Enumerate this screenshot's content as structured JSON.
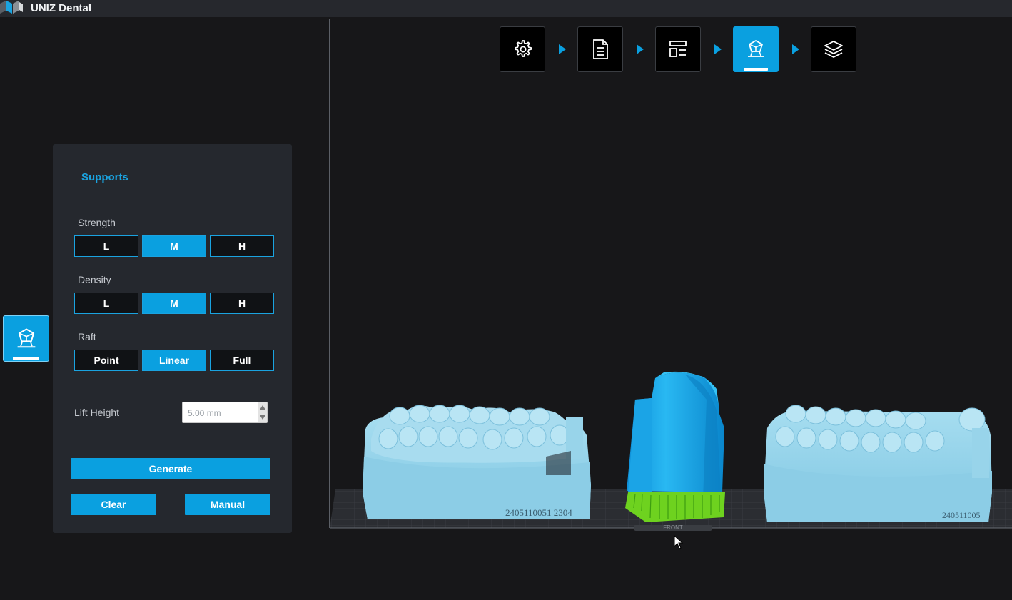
{
  "app": {
    "title": "UNIZ Dental"
  },
  "steps": [
    {
      "name": "settings",
      "icon": "gear-icon",
      "active": false
    },
    {
      "name": "document",
      "icon": "document-icon",
      "active": false
    },
    {
      "name": "layout",
      "icon": "layout-icon",
      "active": false
    },
    {
      "name": "supports",
      "icon": "supports-icon",
      "active": true
    },
    {
      "name": "layers",
      "icon": "layers-icon",
      "active": false
    }
  ],
  "panel": {
    "title": "Supports",
    "strength": {
      "label": "Strength",
      "options": [
        "L",
        "M",
        "H"
      ],
      "selected": "M"
    },
    "density": {
      "label": "Density",
      "options": [
        "L",
        "M",
        "H"
      ],
      "selected": "M"
    },
    "raft": {
      "label": "Raft",
      "options": [
        "Point",
        "Linear",
        "Full"
      ],
      "selected": "Linear"
    },
    "lift_height": {
      "label": "Lift Height",
      "value": "5.00 mm"
    },
    "generate_label": "Generate",
    "clear_label": "Clear",
    "manual_label": "Manual"
  },
  "viewport": {
    "model_labels": [
      "2405110051   2304",
      "240511005"
    ],
    "front_label": "FRONT"
  },
  "colors": {
    "accent": "#0aa0e0",
    "model": "#8fd1ea",
    "support_model": "#1eb0ee",
    "supports": "#6ed21f"
  }
}
